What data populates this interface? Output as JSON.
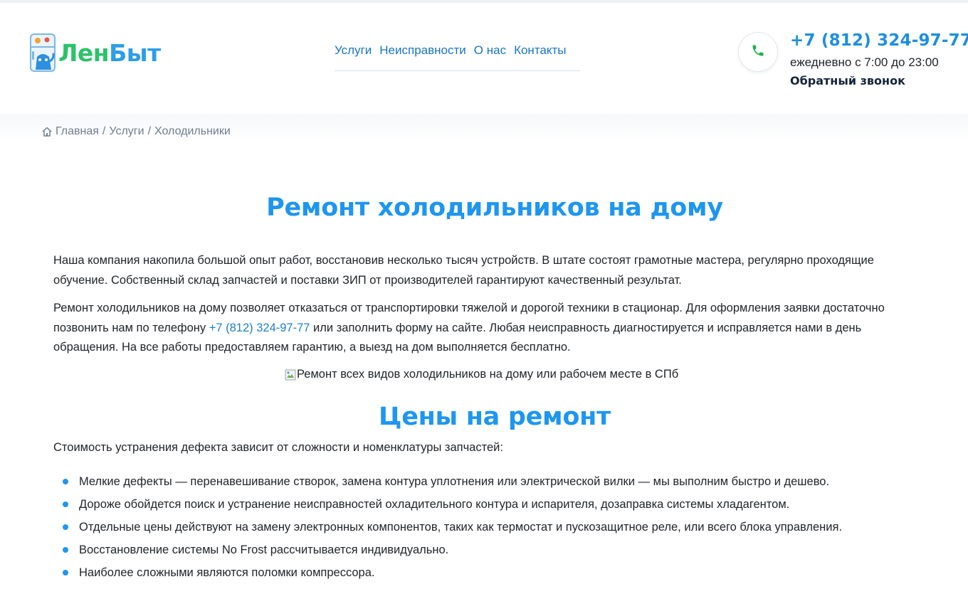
{
  "colors": {
    "accent": "#1e96f0",
    "brand_green": "#2ec16b",
    "brand_blue": "#2c9ee8",
    "link": "#1a73c9",
    "text": "#1f2328"
  },
  "header": {
    "logo": {
      "part1": "Лен",
      "part2": "Быт",
      "icon": "fridge-logo-icon"
    },
    "nav": [
      {
        "label": "Услуги"
      },
      {
        "label": "Неисправности"
      },
      {
        "label": "О нас"
      },
      {
        "label": "Контакты"
      }
    ],
    "contact": {
      "icon": "phone-icon",
      "phone": "+7 (812) 324-97-77",
      "hours": "ежедневно с 7:00 до 23:00",
      "callback": "Обратный звонок"
    }
  },
  "breadcrumb": {
    "icon": "home-icon",
    "items": [
      "Главная",
      "Услуги",
      "Холодильники"
    ],
    "separator": "/"
  },
  "main": {
    "title": "Ремонт холодильников на дому",
    "para1": "Наша компания накопила большой опыт работ, восстановив несколько тысяч устройств. В штате состоят грамотные мастера, регулярно проходящие обучение. Собственный склад запчастей и поставки ЗИП от производителей гарантируют качественный результат.",
    "para2_before": "Ремонт холодильников на дому позволяет отказаться от транспортировки тяжелой и дорогой техники в стационар. Для оформления заявки достаточно позвонить нам по телефону ",
    "para2_link": "+7 (812) 324-97-77",
    "para2_after": " или заполнить форму на сайте. Любая неисправность диагностируется и исправляется нами в день обращения. На все работы предоставляем гарантию, а выезд на дом выполняется бесплатно.",
    "image_alt": "Ремонт всех видов холодильников на дому или рабочем месте в СПб",
    "prices_title": "Цены на ремонт",
    "prices_intro": "Стоимость устранения дефекта зависит от сложности и номенклатуры запчастей:",
    "prices_list": [
      "Мелкие дефекты — перенавешивание створок, замена контура уплотнения или электрической вилки — мы выполним быстро и дешево.",
      "Дороже обойдется поиск и устранение неисправностей охладительного контура и испарителя, дозаправка системы хладагентом.",
      "Отдельные цены действуют на замену электронных компонентов, таких как термостат и пускозащитное реле, или всего блока управления.",
      "Восстановление системы No Frost рассчитывается индивидуально.",
      "Наиболее сложными являются поломки компрессора."
    ]
  }
}
